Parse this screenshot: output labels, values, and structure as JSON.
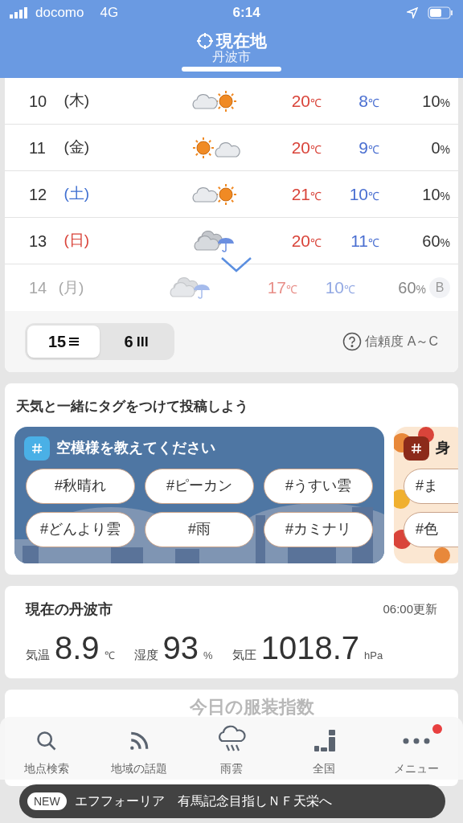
{
  "status_bar": {
    "carrier": "docomo",
    "network": "4G",
    "time": "6:14"
  },
  "header": {
    "title": "現在地",
    "subtitle": "丹波市"
  },
  "forecast": {
    "rows": [
      {
        "day": "10",
        "weekday": "(木)",
        "color": "#333333",
        "kind": "cloudy_sunny",
        "high": "20",
        "low": "8",
        "unit": "℃",
        "precip": "10",
        "precip_unit": "%",
        "faded": false
      },
      {
        "day": "11",
        "weekday": "(金)",
        "color": "#333333",
        "kind": "sunny_cloudy",
        "high": "20",
        "low": "9",
        "unit": "℃",
        "precip": "0",
        "precip_unit": "%",
        "faded": false
      },
      {
        "day": "12",
        "weekday": "(土)",
        "color": "#3f6fd1",
        "kind": "cloudy_sunny",
        "high": "21",
        "low": "10",
        "unit": "℃",
        "precip": "10",
        "precip_unit": "%",
        "faded": false
      },
      {
        "day": "13",
        "weekday": "(日)",
        "color": "#d9443a",
        "kind": "cloudy_rain",
        "high": "20",
        "low": "11",
        "unit": "℃",
        "precip": "60",
        "precip_unit": "%",
        "faded": false
      },
      {
        "day": "14",
        "weekday": "(月)",
        "color": "#a8a8a8",
        "kind": "cloudy_rain",
        "high": "17",
        "low": "10",
        "unit": "℃",
        "precip": "60",
        "precip_unit": "%",
        "faded": true,
        "reliability": "B"
      }
    ],
    "toggle": [
      {
        "label": "15",
        "kind": "list",
        "selected": true
      },
      {
        "label": "6",
        "kind": "columns",
        "selected": false
      }
    ],
    "reliability_label": "信頼度 A～C"
  },
  "tags_section": {
    "title": "天気と一緒にタグをつけて投稿しよう",
    "cards": [
      {
        "kind": "city",
        "title": "空模様を教えてください",
        "tags": [
          "#秋晴れ",
          "#ピーカン",
          "#うすい雲",
          "#どんより雲",
          "#雨",
          "#カミナリ"
        ]
      },
      {
        "kind": "autumn",
        "title": "身",
        "tags": [
          "#ま",
          "#色"
        ]
      }
    ]
  },
  "current": {
    "title": "現在の丹波市",
    "updated": "06:00更新",
    "readings": [
      {
        "label": "気温",
        "value": "8.9",
        "unit": "℃"
      },
      {
        "label": "湿度",
        "value": "93",
        "unit": "%"
      },
      {
        "label": "気圧",
        "value": "1018.7",
        "unit": "hPa"
      }
    ]
  },
  "next_card": {
    "title": "今日の服装指数"
  },
  "nav": [
    {
      "kind": "search",
      "label": "地点検索",
      "badge": false
    },
    {
      "kind": "rss",
      "label": "地域の話題",
      "badge": false
    },
    {
      "kind": "rain",
      "label": "雨雲",
      "badge": false
    },
    {
      "kind": "map",
      "label": "全国",
      "badge": false
    },
    {
      "kind": "more",
      "label": "メニュー",
      "badge": true
    }
  ],
  "ticker": {
    "badge": "NEW",
    "text": "エフフォーリア　有馬記念目指しＮＦ天栄へ"
  }
}
